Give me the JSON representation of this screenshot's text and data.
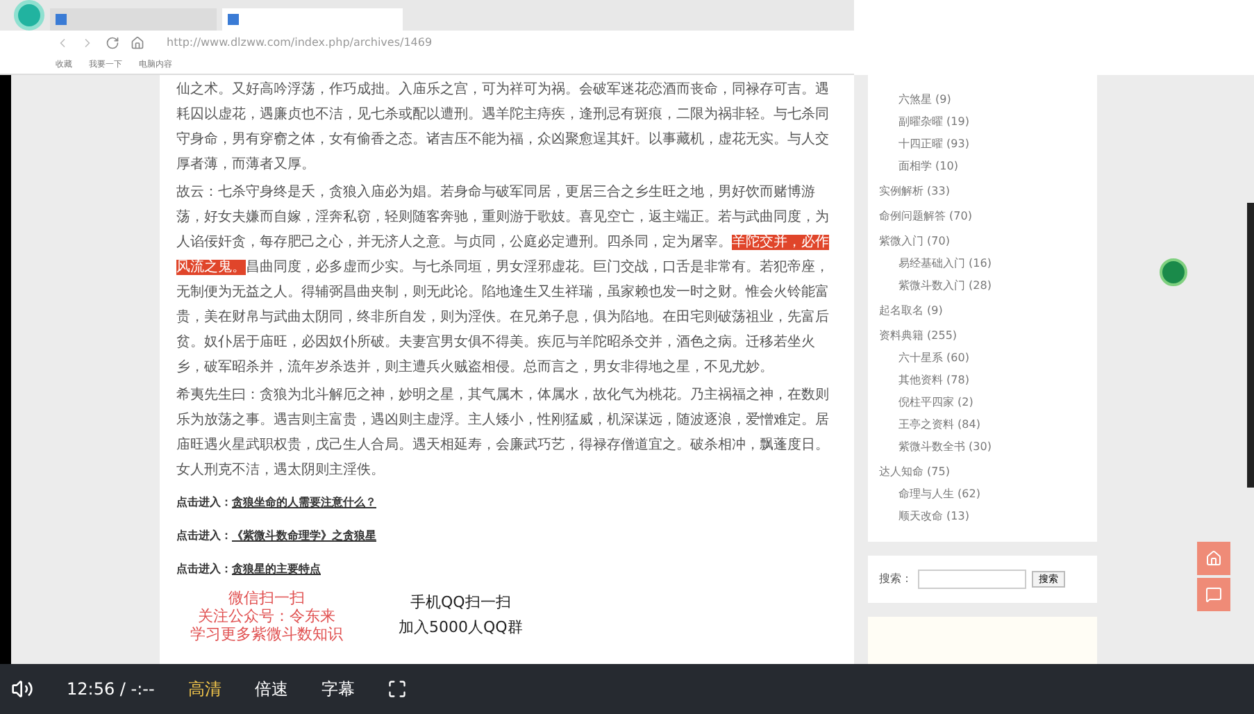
{
  "browser": {
    "url": "http://www.dlzww.com/index.php/archives/1469",
    "bookmarks": [
      "收藏",
      "我要一下",
      "电脑内容"
    ]
  },
  "article": {
    "paragraphs": [
      {
        "before": "仙之术。又好高吟浮荡，作巧成拙。入庙乐之宫，可为祥可为祸。会破军迷花恋酒而丧命，同禄存可吉。遇耗囚以虚花，遇廉贞也不洁，见七杀或配以遭刑。遇羊陀主痔疾，逢刑忌有斑痕，二限为祸非轻。与七杀同守身命，男有穿窬之体，女有偷香之态。诸吉压不能为福，众凶聚愈逞其奸。以事藏机，虚花无实。与人交厚者薄，而薄者又厚。"
      },
      {
        "before": "故云：七杀守身终是夭，贪狼入庙必为娼。若身命与破军同居，更居三合之乡生旺之地，男好饮而赌博游荡，好女夫嫌而自嫁，淫奔私窃，轻则随客奔驰，重则游于歌妓。喜见空亡，返主端正。若与武曲同度，为人谄佞奸贪，每存肥己之心，并无济人之意。与贞同，公庭必定遭刑。四杀同，定为屠宰。",
        "highlighted": "羊陀交并，必作风流之鬼。",
        "after": "昌曲同度，必多虚而少实。与七杀同垣，男女淫邪虚花。巨门交战，口舌是非常有。若犯帝座，无制便为无益之人。得辅弼昌曲夹制，则无此论。陷地逢生又生祥瑞，虽家赖也发一时之财。惟会火铃能富贵，美在财帛与武曲太阴同，终非所自发，则为淫佚。在兄弟子息，俱为陷地。在田宅则破荡祖业，先富后贫。奴仆居于庙旺，必因奴仆所破。夫妻宫男女俱不得美。疾厄与羊陀昭杀交并，酒色之病。迁移若坐火乡，破军昭杀并，流年岁杀迭并，则主遭兵火贼盗相侵。总而言之，男女非得地之星，不见尤妙。"
      },
      {
        "before": "希夷先生曰：贪狼为北斗解厄之神，妙明之星，其气属木，体属水，故化气为桃花。乃主祸福之神，在数则乐为放荡之事。遇吉则主富贵，遇凶则主虚浮。主人矮小，性刚猛威，机深谋远，随波逐浪，爱憎难定。居庙旺遇火星武职权贵，戊己生人合局。遇天相延寿，会廉武巧艺，得禄存僧道宜之。破杀相冲，飘蓬度日。女人刑克不洁，遇太阴则主淫佚。"
      }
    ],
    "links": [
      {
        "prefix": "点击进入：",
        "label": "贪狼坐命的人需要注意什么？"
      },
      {
        "prefix": "点击进入：",
        "label": "《紫微斗数命理学》之贪狼星"
      },
      {
        "prefix": "点击进入：",
        "label": "贪狼星的主要特点"
      }
    ],
    "wechat_lines": [
      "微信扫一扫",
      "关注公众号：令东来",
      "学习更多紫微斗数知识"
    ],
    "qq_lines": [
      "手机QQ扫一扫",
      "加入5000人QQ群"
    ]
  },
  "sidebar": {
    "categories": [
      {
        "label": "六煞星 (9)"
      },
      {
        "label": "副曜杂曜 (19)"
      },
      {
        "label": "十四正曜 (93)"
      },
      {
        "label": "面相学 (10)"
      }
    ],
    "groups": [
      {
        "label": "实例解析 (33)"
      },
      {
        "label": "命例问题解答 (70)"
      },
      {
        "label": "紫微入门 (70)",
        "children": [
          {
            "label": "易经基础入门 (16)"
          },
          {
            "label": "紫微斗数入门 (28)"
          }
        ]
      },
      {
        "label": "起名取名 (9)"
      },
      {
        "label": "资料典籍 (255)",
        "children": [
          {
            "label": "六十星系 (60)"
          },
          {
            "label": "其他资料 (78)"
          },
          {
            "label": "倪柱平四家 (2)"
          },
          {
            "label": "王亭之资料 (84)"
          },
          {
            "label": "紫微斗数全书 (30)"
          }
        ]
      },
      {
        "label": "达人知命 (75)",
        "children": [
          {
            "label": "命理与人生 (62)"
          },
          {
            "label": "顺天改命 (13)"
          }
        ]
      }
    ],
    "search_label": "搜索：",
    "search_button": "搜索"
  },
  "player": {
    "time": "12:56 / -:--",
    "quality": "高清",
    "speed": "倍速",
    "subtitles": "字幕",
    "quality_selected": true
  }
}
